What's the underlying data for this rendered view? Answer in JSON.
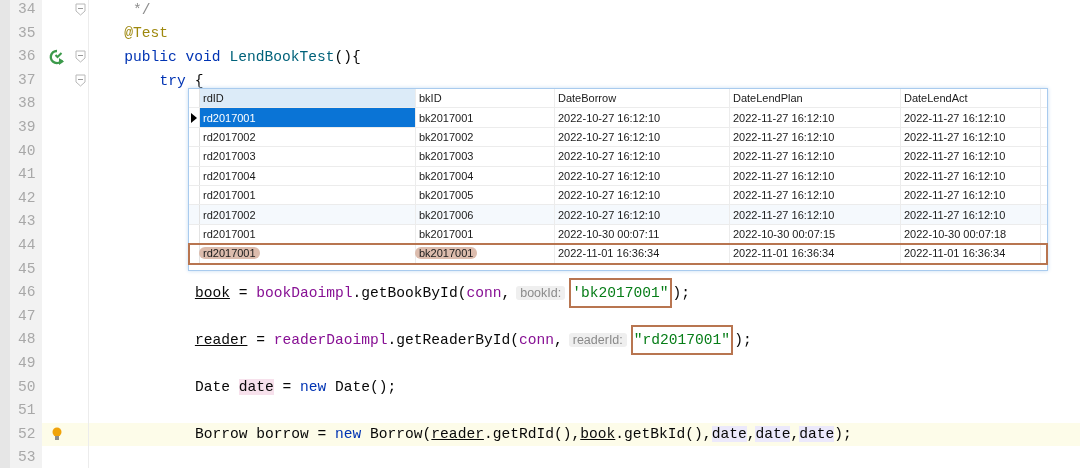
{
  "editor": {
    "lines": [
      {
        "number": "34",
        "fold": true,
        "tokens": [
          {
            "kind": "comment",
            "text": " */"
          }
        ]
      },
      {
        "number": "35",
        "fold": false,
        "tokens": [
          {
            "kind": "anno",
            "text": "@Test"
          }
        ]
      },
      {
        "number": "36",
        "fold": true,
        "gutter": {
          "kind": "run"
        },
        "tokens": [
          {
            "kind": "kw",
            "text": "public void "
          },
          {
            "kind": "decl",
            "text": "LendBookTest"
          },
          {
            "kind": "plain",
            "text": "(){"
          }
        ],
        "children": [
          {
            "number": "37",
            "fold": true,
            "tokens": [
              {
                "kind": "kw",
                "text": "try "
              },
              {
                "kind": "plain",
                "text": "{"
              }
            ],
            "children": [
              {
                "number": "38",
                "fold": false
              },
              {
                "number": "39",
                "fold": false
              },
              {
                "number": "40",
                "fold": false
              },
              {
                "number": "41",
                "fold": false
              },
              {
                "number": "42",
                "fold": false
              },
              {
                "number": "43",
                "fold": false
              },
              {
                "number": "44",
                "fold": false
              },
              {
                "number": "45",
                "fold": false
              },
              {
                "number": "46",
                "fold": false,
                "tokens": [
                  {
                    "kind": "ref",
                    "text": "book"
                  },
                  {
                    "kind": "plain",
                    "text": " = "
                  },
                  {
                    "kind": "field",
                    "text": "bookDaoimpl"
                  },
                  {
                    "kind": "plain",
                    "text": ".getBookById("
                  },
                  {
                    "kind": "field",
                    "text": "conn"
                  },
                  {
                    "kind": "plain",
                    "text": ","
                  },
                  {
                    "kind": "hint",
                    "text": "bookId:"
                  },
                  {
                    "kind": "str",
                    "text": "'bk2017001\"",
                    "boxed": true
                  },
                  {
                    "kind": "plain",
                    "text": ");"
                  }
                ]
              },
              {
                "number": "47",
                "fold": false
              },
              {
                "number": "48",
                "fold": false,
                "tokens": [
                  {
                    "kind": "ref",
                    "text": "reader"
                  },
                  {
                    "kind": "plain",
                    "text": " = "
                  },
                  {
                    "kind": "field",
                    "text": "readerDaoimpl"
                  },
                  {
                    "kind": "plain",
                    "text": ".getReaderById("
                  },
                  {
                    "kind": "field",
                    "text": "conn"
                  },
                  {
                    "kind": "plain",
                    "text": ","
                  },
                  {
                    "kind": "hint",
                    "text": "readerId:"
                  },
                  {
                    "kind": "str",
                    "text": "\"rd2017001\"",
                    "boxed": true
                  },
                  {
                    "kind": "plain",
                    "text": ");"
                  }
                ]
              },
              {
                "number": "49",
                "fold": false
              },
              {
                "number": "50",
                "fold": false,
                "tokens": [
                  {
                    "kind": "plain",
                    "text": "Date "
                  },
                  {
                    "kind": "local",
                    "text": "date"
                  },
                  {
                    "kind": "plain",
                    "text": " = "
                  },
                  {
                    "kind": "kw",
                    "text": "new"
                  },
                  {
                    "kind": "plain",
                    "text": " Date();"
                  }
                ]
              },
              {
                "number": "51",
                "fold": false
              },
              {
                "number": "52",
                "fold": false,
                "current": true,
                "gutter": {
                  "kind": "bulb"
                },
                "tokens": [
                  {
                    "kind": "plain",
                    "text": "Borrow borrow = "
                  },
                  {
                    "kind": "kw",
                    "text": "new"
                  },
                  {
                    "kind": "plain",
                    "text": " Borrow("
                  },
                  {
                    "kind": "ref",
                    "text": "reader"
                  },
                  {
                    "kind": "plain",
                    "text": ".getRdId(),"
                  },
                  {
                    "kind": "ref",
                    "text": "book"
                  },
                  {
                    "kind": "plain",
                    "text": ".getBkId(),"
                  },
                  {
                    "kind": "param",
                    "text": "date"
                  },
                  {
                    "kind": "plain",
                    "text": ","
                  },
                  {
                    "kind": "param",
                    "text": "date"
                  },
                  {
                    "kind": "plain",
                    "text": ","
                  },
                  {
                    "kind": "param",
                    "text": "date"
                  },
                  {
                    "kind": "plain",
                    "text": ");"
                  }
                ]
              },
              {
                "number": "53",
                "fold": false
              }
            ]
          }
        ]
      }
    ]
  },
  "result_table": {
    "columns": [
      "rdID",
      "bkID",
      "DateBorrow",
      "DateLendPlan",
      "DateLendAct"
    ],
    "rows": [
      {
        "selected": true,
        "boxed": false,
        "cells": [
          "rd2017001",
          "bk2017001",
          "2022-10-27 16:12:10",
          "2022-11-27 16:12:10",
          "2022-11-27 16:12:10"
        ]
      },
      {
        "selected": false,
        "boxed": false,
        "cells": [
          "rd2017002",
          "bk2017002",
          "2022-10-27 16:12:10",
          "2022-11-27 16:12:10",
          "2022-11-27 16:12:10"
        ]
      },
      {
        "selected": false,
        "boxed": false,
        "cells": [
          "rd2017003",
          "bk2017003",
          "2022-10-27 16:12:10",
          "2022-11-27 16:12:10",
          "2022-11-27 16:12:10"
        ]
      },
      {
        "selected": false,
        "boxed": false,
        "cells": [
          "rd2017004",
          "bk2017004",
          "2022-10-27 16:12:10",
          "2022-11-27 16:12:10",
          "2022-11-27 16:12:10"
        ]
      },
      {
        "selected": false,
        "boxed": false,
        "cells": [
          "rd2017001",
          "bk2017005",
          "2022-10-27 16:12:10",
          "2022-11-27 16:12:10",
          "2022-11-27 16:12:10"
        ]
      },
      {
        "selected": false,
        "boxed": false,
        "cells": [
          "rd2017002",
          "bk2017006",
          "2022-10-27 16:12:10",
          "2022-11-27 16:12:10",
          "2022-11-27 16:12:10"
        ]
      },
      {
        "selected": false,
        "boxed": false,
        "cells": [
          "rd2017001",
          "bk2017001",
          "2022-10-30 00:07:11",
          "2022-10-30 00:07:15",
          "2022-10-30 00:07:18"
        ]
      },
      {
        "selected": false,
        "boxed": true,
        "cells": [
          "rd2017001",
          "bk2017001",
          "2022-11-01 16:36:34",
          "2022-11-01 16:36:34",
          "2022-11-01 16:36:34"
        ]
      }
    ]
  }
}
